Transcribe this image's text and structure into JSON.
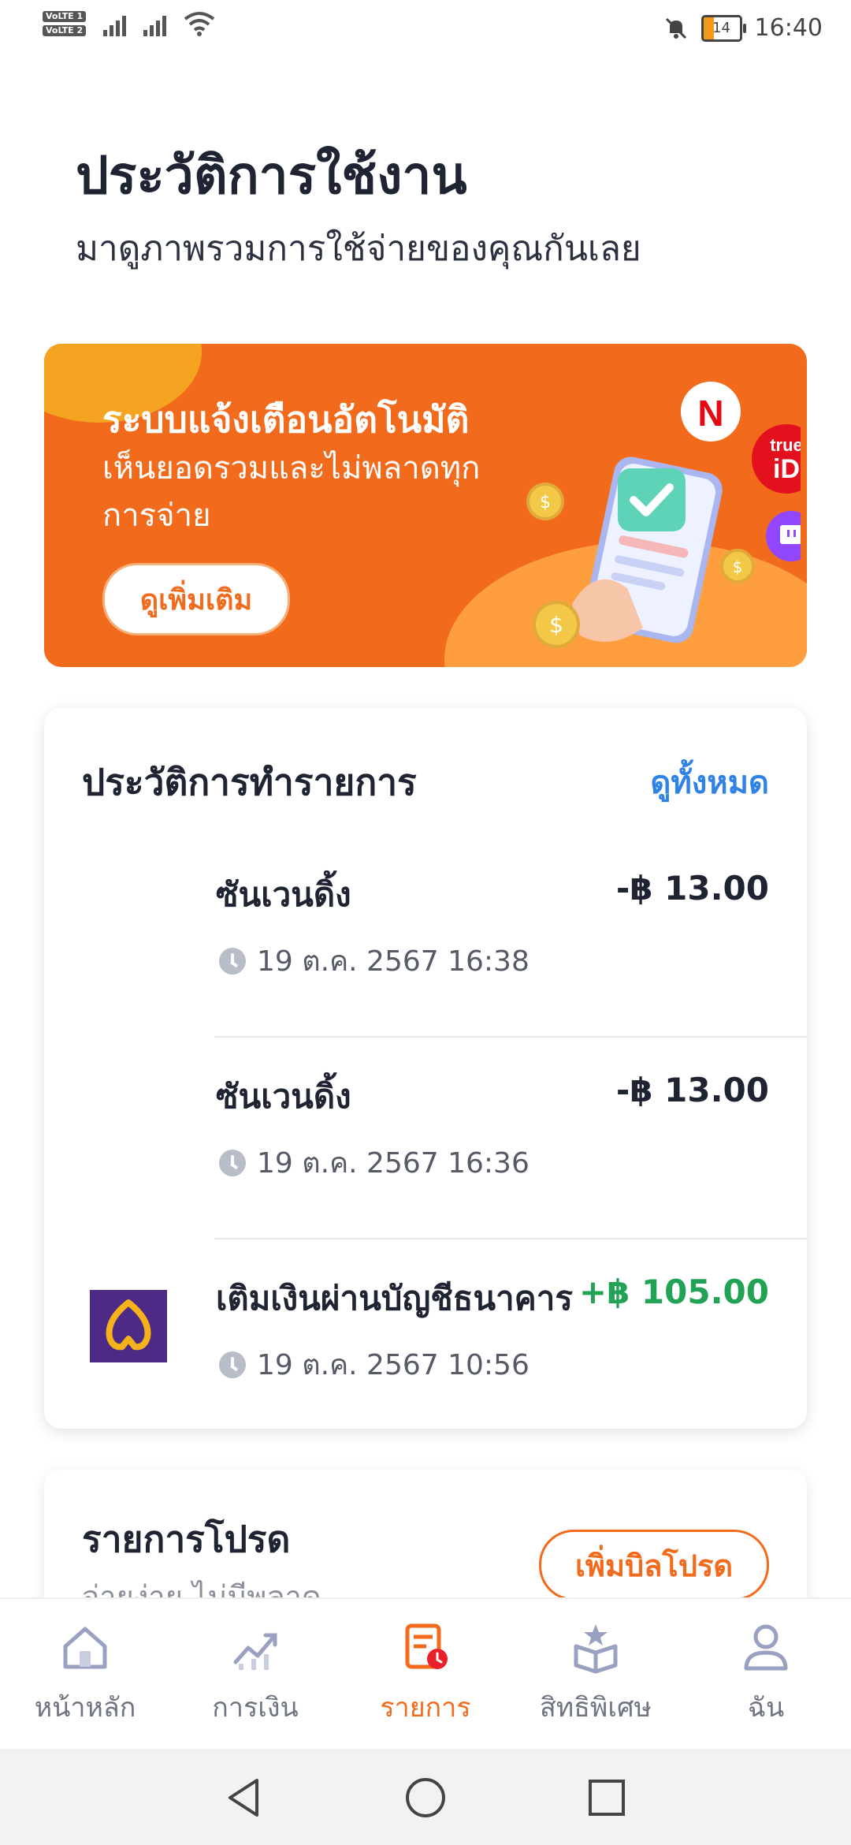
{
  "status_bar": {
    "sim1": "VoLTE 1",
    "sim2": "VoLTE 2",
    "battery": "14",
    "time": "16:40"
  },
  "header": {
    "title": "ประวัติการใช้งาน",
    "subtitle": "มาดูภาพรวมการใช้จ่ายของคุณกันเลย"
  },
  "banner": {
    "title": "ระบบแจ้งเตือนอัตโนมัติ",
    "text": "เห็นยอดรวมและไม่พลาดทุกการจ่าย",
    "button": "ดูเพิ่มเติม",
    "service_labels": [
      "N",
      "true iD"
    ]
  },
  "transactions": {
    "title": "ประวัติการทำรายการ",
    "view_all": "ดูทั้งหมด",
    "items": [
      {
        "title": "ซันเวนดิ้ง",
        "amount": "-฿ 13.00",
        "time": "19 ต.ค. 2567 16:38"
      },
      {
        "title": "ซันเวนดิ้ง",
        "amount": "-฿ 13.00",
        "time": "19 ต.ค. 2567 16:36"
      },
      {
        "title": "เติมเงินผ่านบัญชีธนาคาร",
        "amount": "+฿ 105.00",
        "time": "19 ต.ค. 2567 10:56"
      }
    ]
  },
  "favorites": {
    "title": "รายการโปรด",
    "subtitle": "จ่ายง่าย ไม่มีพลาด",
    "button": "เพิ่มบิลโปรด"
  },
  "bottom_nav": {
    "items": [
      {
        "label": "หน้าหลัก",
        "icon": "home-icon"
      },
      {
        "label": "การเงิน",
        "icon": "finance-chart-icon"
      },
      {
        "label": "รายการ",
        "icon": "transactions-icon",
        "active": true
      },
      {
        "label": "สิทธิพิเศษ",
        "icon": "privilege-box-icon"
      },
      {
        "label": "ฉัน",
        "icon": "profile-icon"
      }
    ]
  },
  "colors": {
    "brand_orange": "#f26a1b",
    "link_blue": "#2f82e6",
    "positive_green": "#22a255"
  }
}
